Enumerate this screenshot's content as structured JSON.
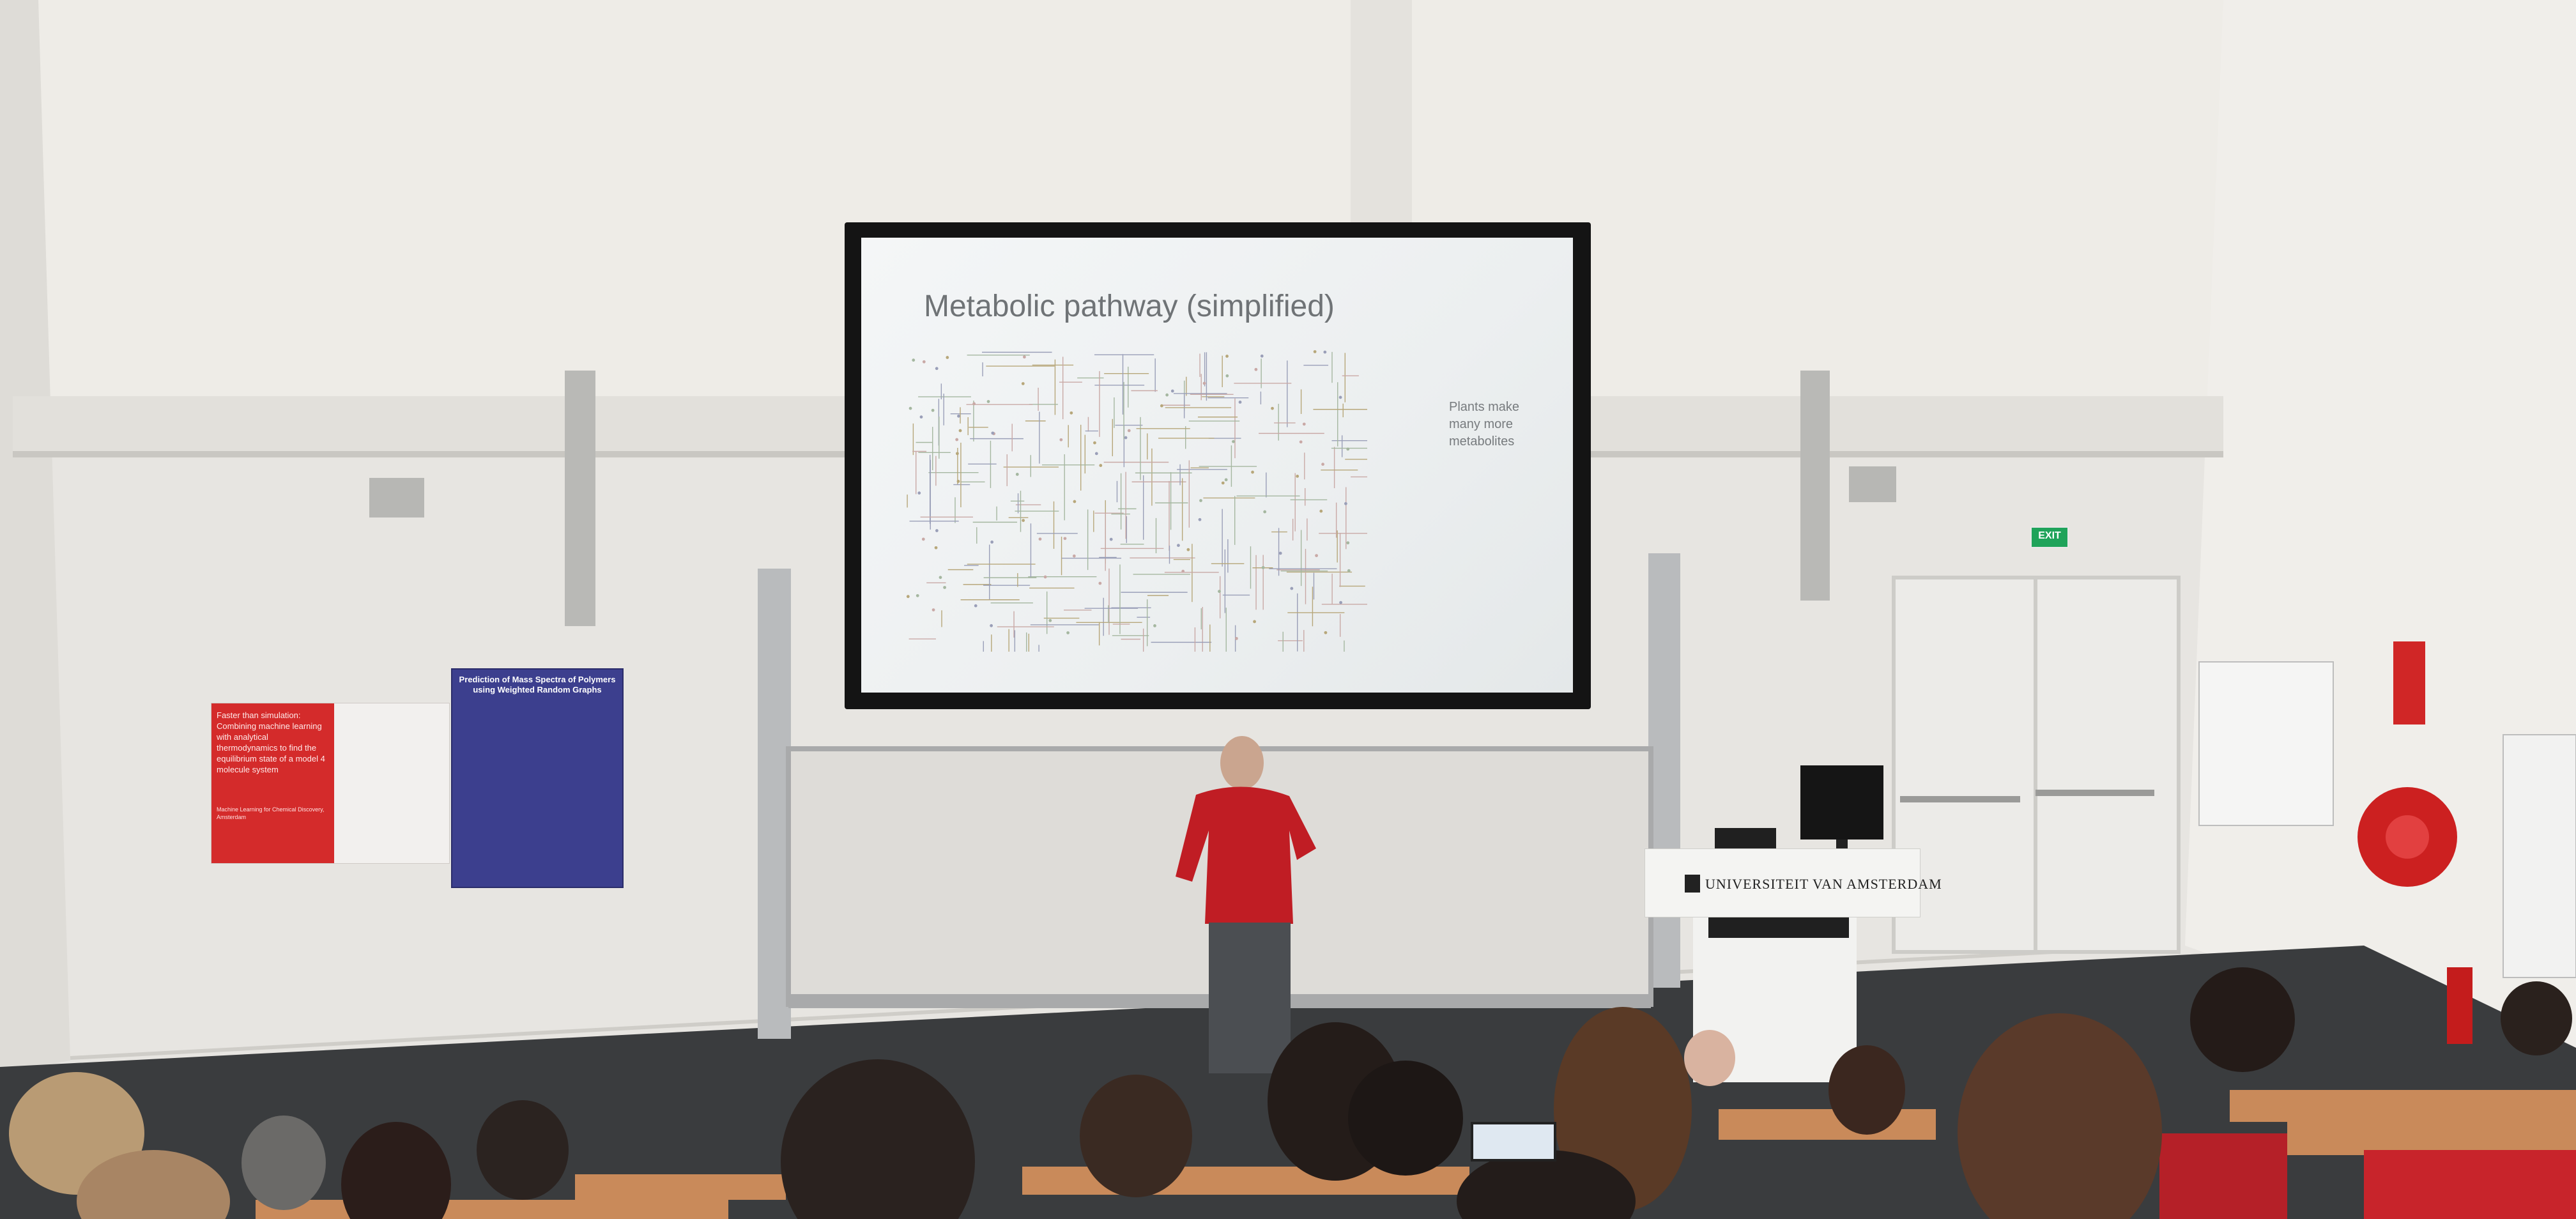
{
  "slide": {
    "title": "Metabolic pathway (simplified)",
    "note_lines": [
      "Plants make",
      "many more",
      "metabolites"
    ]
  },
  "poster_left": {
    "heading": "Faster than simulation: Combining machine learning with analytical thermodynamics to find the equilibrium state of a model 4 molecule system",
    "footer": "Machine Learning for Chemical Discovery, Amsterdam"
  },
  "poster_right": {
    "title": "Prediction of Mass Spectra of Polymers using Weighted Random Graphs"
  },
  "lectern": {
    "label": "UNIVERSITEIT VAN AMSTERDAM"
  },
  "exit_sign": {
    "text": "EXIT"
  },
  "colors": {
    "wall": "#e9e7e2",
    "floor": "#3a3c3e",
    "seat_wood": "#c98a5a",
    "seat_red": "#c8242b",
    "presenter_jacket": "#c01d24",
    "pathway_lines": [
      "#9a9fb8",
      "#b7a77a",
      "#a5b7a0",
      "#c9a9a6"
    ]
  }
}
